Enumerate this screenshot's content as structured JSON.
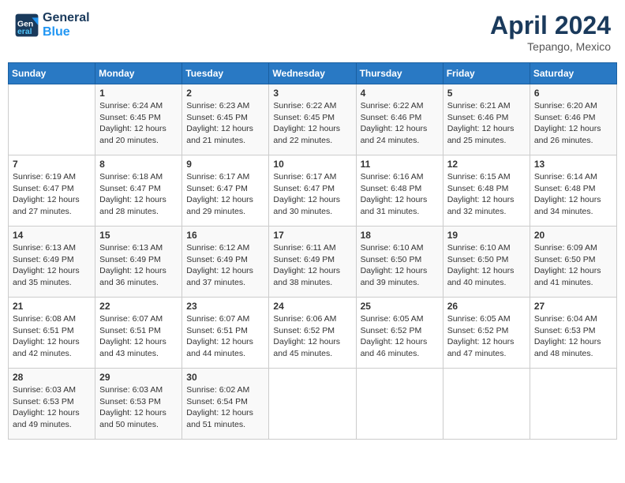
{
  "header": {
    "logo_line1": "General",
    "logo_line2": "Blue",
    "month": "April 2024",
    "location": "Tepango, Mexico"
  },
  "days_of_week": [
    "Sunday",
    "Monday",
    "Tuesday",
    "Wednesday",
    "Thursday",
    "Friday",
    "Saturday"
  ],
  "weeks": [
    [
      {
        "day": "",
        "info": ""
      },
      {
        "day": "1",
        "info": "Sunrise: 6:24 AM\nSunset: 6:45 PM\nDaylight: 12 hours\nand 20 minutes."
      },
      {
        "day": "2",
        "info": "Sunrise: 6:23 AM\nSunset: 6:45 PM\nDaylight: 12 hours\nand 21 minutes."
      },
      {
        "day": "3",
        "info": "Sunrise: 6:22 AM\nSunset: 6:45 PM\nDaylight: 12 hours\nand 22 minutes."
      },
      {
        "day": "4",
        "info": "Sunrise: 6:22 AM\nSunset: 6:46 PM\nDaylight: 12 hours\nand 24 minutes."
      },
      {
        "day": "5",
        "info": "Sunrise: 6:21 AM\nSunset: 6:46 PM\nDaylight: 12 hours\nand 25 minutes."
      },
      {
        "day": "6",
        "info": "Sunrise: 6:20 AM\nSunset: 6:46 PM\nDaylight: 12 hours\nand 26 minutes."
      }
    ],
    [
      {
        "day": "7",
        "info": "Sunrise: 6:19 AM\nSunset: 6:47 PM\nDaylight: 12 hours\nand 27 minutes."
      },
      {
        "day": "8",
        "info": "Sunrise: 6:18 AM\nSunset: 6:47 PM\nDaylight: 12 hours\nand 28 minutes."
      },
      {
        "day": "9",
        "info": "Sunrise: 6:17 AM\nSunset: 6:47 PM\nDaylight: 12 hours\nand 29 minutes."
      },
      {
        "day": "10",
        "info": "Sunrise: 6:17 AM\nSunset: 6:47 PM\nDaylight: 12 hours\nand 30 minutes."
      },
      {
        "day": "11",
        "info": "Sunrise: 6:16 AM\nSunset: 6:48 PM\nDaylight: 12 hours\nand 31 minutes."
      },
      {
        "day": "12",
        "info": "Sunrise: 6:15 AM\nSunset: 6:48 PM\nDaylight: 12 hours\nand 32 minutes."
      },
      {
        "day": "13",
        "info": "Sunrise: 6:14 AM\nSunset: 6:48 PM\nDaylight: 12 hours\nand 34 minutes."
      }
    ],
    [
      {
        "day": "14",
        "info": "Sunrise: 6:13 AM\nSunset: 6:49 PM\nDaylight: 12 hours\nand 35 minutes."
      },
      {
        "day": "15",
        "info": "Sunrise: 6:13 AM\nSunset: 6:49 PM\nDaylight: 12 hours\nand 36 minutes."
      },
      {
        "day": "16",
        "info": "Sunrise: 6:12 AM\nSunset: 6:49 PM\nDaylight: 12 hours\nand 37 minutes."
      },
      {
        "day": "17",
        "info": "Sunrise: 6:11 AM\nSunset: 6:49 PM\nDaylight: 12 hours\nand 38 minutes."
      },
      {
        "day": "18",
        "info": "Sunrise: 6:10 AM\nSunset: 6:50 PM\nDaylight: 12 hours\nand 39 minutes."
      },
      {
        "day": "19",
        "info": "Sunrise: 6:10 AM\nSunset: 6:50 PM\nDaylight: 12 hours\nand 40 minutes."
      },
      {
        "day": "20",
        "info": "Sunrise: 6:09 AM\nSunset: 6:50 PM\nDaylight: 12 hours\nand 41 minutes."
      }
    ],
    [
      {
        "day": "21",
        "info": "Sunrise: 6:08 AM\nSunset: 6:51 PM\nDaylight: 12 hours\nand 42 minutes."
      },
      {
        "day": "22",
        "info": "Sunrise: 6:07 AM\nSunset: 6:51 PM\nDaylight: 12 hours\nand 43 minutes."
      },
      {
        "day": "23",
        "info": "Sunrise: 6:07 AM\nSunset: 6:51 PM\nDaylight: 12 hours\nand 44 minutes."
      },
      {
        "day": "24",
        "info": "Sunrise: 6:06 AM\nSunset: 6:52 PM\nDaylight: 12 hours\nand 45 minutes."
      },
      {
        "day": "25",
        "info": "Sunrise: 6:05 AM\nSunset: 6:52 PM\nDaylight: 12 hours\nand 46 minutes."
      },
      {
        "day": "26",
        "info": "Sunrise: 6:05 AM\nSunset: 6:52 PM\nDaylight: 12 hours\nand 47 minutes."
      },
      {
        "day": "27",
        "info": "Sunrise: 6:04 AM\nSunset: 6:53 PM\nDaylight: 12 hours\nand 48 minutes."
      }
    ],
    [
      {
        "day": "28",
        "info": "Sunrise: 6:03 AM\nSunset: 6:53 PM\nDaylight: 12 hours\nand 49 minutes."
      },
      {
        "day": "29",
        "info": "Sunrise: 6:03 AM\nSunset: 6:53 PM\nDaylight: 12 hours\nand 50 minutes."
      },
      {
        "day": "30",
        "info": "Sunrise: 6:02 AM\nSunset: 6:54 PM\nDaylight: 12 hours\nand 51 minutes."
      },
      {
        "day": "",
        "info": ""
      },
      {
        "day": "",
        "info": ""
      },
      {
        "day": "",
        "info": ""
      },
      {
        "day": "",
        "info": ""
      }
    ]
  ]
}
